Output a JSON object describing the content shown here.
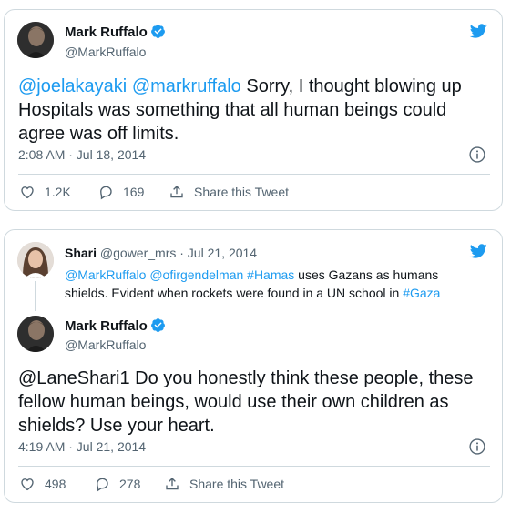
{
  "tweet1": {
    "name": "Mark Ruffalo",
    "handle": "@MarkRuffalo",
    "mention1": "@joelakayaki",
    "mention2": "@markruffalo",
    "body": " Sorry, I thought blowing up Hospitals was something that all human beings could agree was off limits.",
    "timestamp": "2:08 AM · Jul 18, 2014",
    "likes": "1.2K",
    "replies": "169",
    "share_label": "Share this Tweet"
  },
  "tweet2": {
    "parent": {
      "name": "Shari",
      "handle": "@gower_mrs",
      "date": "· Jul 21, 2014",
      "mention1": "@MarkRuffalo",
      "mention2": "@ofirgendelman",
      "hashtag1": "#Hamas",
      "text1": " uses Gazans as humans shields. Evident when rockets were found in a UN school in ",
      "hashtag2": "#Gaza"
    },
    "name": "Mark Ruffalo",
    "handle": "@MarkRuffalo",
    "body": "@LaneShari1 Do you honestly think these people, these fellow human beings, would use their own children as shields? Use your heart.",
    "timestamp": "4:19 AM · Jul 21, 2014",
    "likes": "498",
    "replies": "278",
    "share_label": "Share this Tweet"
  },
  "colors": {
    "accent": "#1d9bf0",
    "secondary_text": "#536471",
    "border": "#cfd9de"
  }
}
